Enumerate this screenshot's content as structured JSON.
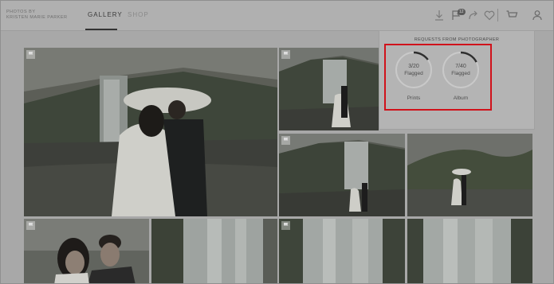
{
  "header": {
    "brand_line1": "PHOTOS BY",
    "brand_line2": "KRISTEN MARIE PARKER",
    "tabs": [
      {
        "label": "GALLERY",
        "active": true
      },
      {
        "label": "SHOP",
        "active": false
      }
    ],
    "notification_count": "12",
    "icons": [
      "download-icon",
      "flag-icon",
      "share-icon",
      "heart-icon",
      "cart-icon",
      "user-icon"
    ]
  },
  "popover": {
    "title": "REQUESTS FROM PHOTOGRAPHER",
    "rings": [
      {
        "count": "3/20",
        "status": "Flagged",
        "caption": "Prints",
        "progress": 0.15
      },
      {
        "count": "7/40",
        "status": "Flagged",
        "caption": "Album",
        "progress": 0.175
      }
    ]
  },
  "gallery": {
    "photos": [
      {
        "name": "photo-couple-umbrella-waterfall"
      },
      {
        "name": "photo-couple-waterfall-small"
      },
      {
        "name": "photo-couple-waterfall-wide"
      },
      {
        "name": "photo-couple-hillside-umbrella"
      },
      {
        "name": "photo-couple-portrait"
      },
      {
        "name": "photo-waterfall-1"
      },
      {
        "name": "photo-waterfall-2"
      },
      {
        "name": "photo-waterfall-3"
      }
    ]
  },
  "colors": {
    "highlight": "#d0121b",
    "overlay": "#a8a8a8"
  }
}
